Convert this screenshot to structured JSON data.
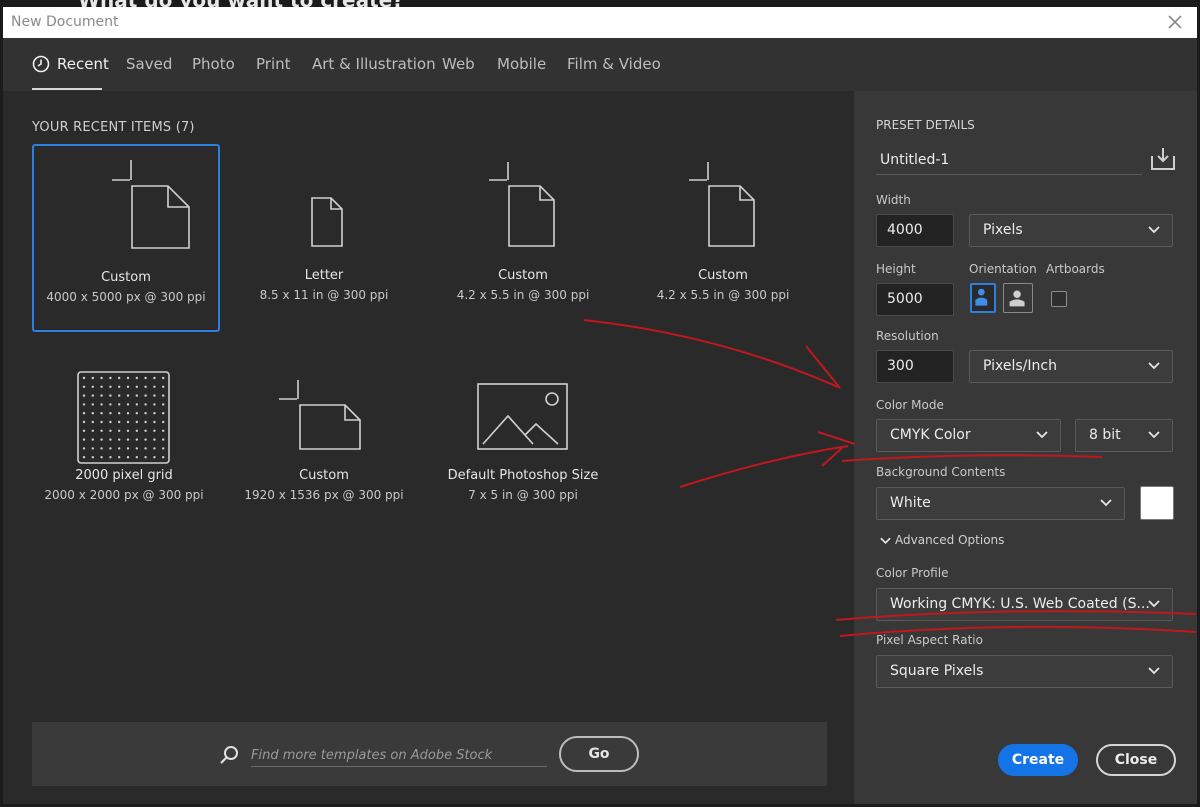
{
  "background_text": "What do you want to create?",
  "window": {
    "title": "New Document"
  },
  "tabs": [
    "Recent",
    "Saved",
    "Photo",
    "Print",
    "Art & Illustration",
    "Web",
    "Mobile",
    "Film & Video"
  ],
  "recent": {
    "heading": "YOUR RECENT ITEMS",
    "count": "(7)",
    "items": [
      {
        "name": "Custom",
        "dims": "4000 x 5000 px @ 300 ppi",
        "icon": "new-document-icon"
      },
      {
        "name": "Letter",
        "dims": "8.5 x 11 in @ 300 ppi",
        "icon": "document-icon"
      },
      {
        "name": "Custom",
        "dims": "4.2 x 5.5 in @ 300 ppi",
        "icon": "new-document-icon"
      },
      {
        "name": "Custom",
        "dims": "4.2 x 5.5 in @ 300 ppi",
        "icon": "new-document-icon"
      },
      {
        "name": "2000 pixel grid",
        "dims": "2000 x 2000 px @ 300 ppi",
        "icon": "grid-icon"
      },
      {
        "name": "Custom",
        "dims": "1920 x 1536 px @ 300 ppi",
        "icon": "new-landscape-document-icon"
      },
      {
        "name": "Default Photoshop Size",
        "dims": "7 x 5 in @ 300 ppi",
        "icon": "image-icon"
      }
    ]
  },
  "stock": {
    "placeholder": "Find more templates on Adobe Stock",
    "go_label": "Go"
  },
  "preset": {
    "heading": "PRESET DETAILS",
    "name": "Untitled-1",
    "width_label": "Width",
    "width": "4000",
    "width_unit": "Pixels",
    "height_label": "Height",
    "height": "5000",
    "orientation_label": "Orientation",
    "artboards_label": "Artboards",
    "resolution_label": "Resolution",
    "resolution": "300",
    "resolution_unit": "Pixels/Inch",
    "color_mode_label": "Color Mode",
    "color_mode": "CMYK Color",
    "bit_depth": "8 bit",
    "bg_label": "Background Contents",
    "bg": "White",
    "advanced_label": "Advanced Options",
    "profile_label": "Color Profile",
    "profile": "Working CMYK: U.S. Web Coated (S...",
    "aspect_label": "Pixel Aspect Ratio",
    "aspect": "Square Pixels",
    "create_label": "Create",
    "close_label": "Close"
  },
  "colors": {
    "accent": "#1473e6",
    "annotation": "#c0181e"
  }
}
